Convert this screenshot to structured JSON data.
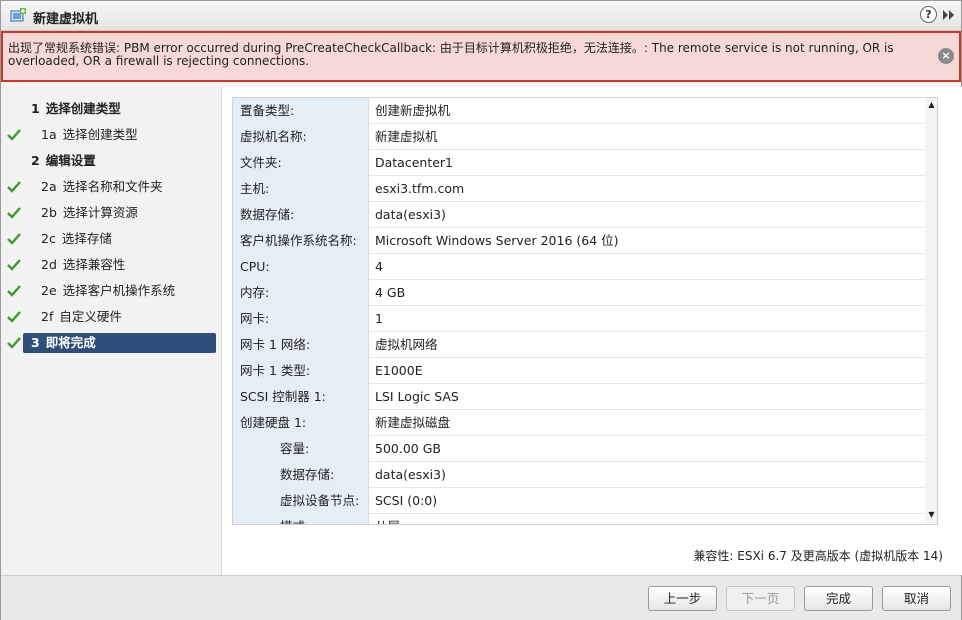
{
  "window": {
    "title": "新建虚拟机",
    "help_label": "?"
  },
  "error": {
    "message": "出现了常规系统错误: PBM error occurred during PreCreateCheckCallback: 由于目标计算机积极拒绝，无法连接。: The remote service is not running, OR is overloaded, OR a firewall is rejecting connections.",
    "close_label": "×"
  },
  "nav": {
    "items": [
      {
        "num": "1",
        "label": "选择创建类型",
        "level": "top",
        "checked": false,
        "active": false
      },
      {
        "num": "1a",
        "label": "选择创建类型",
        "level": "sub",
        "checked": true,
        "active": false
      },
      {
        "num": "2",
        "label": "编辑设置",
        "level": "top",
        "checked": false,
        "active": false
      },
      {
        "num": "2a",
        "label": "选择名称和文件夹",
        "level": "sub",
        "checked": true,
        "active": false
      },
      {
        "num": "2b",
        "label": "选择计算资源",
        "level": "sub",
        "checked": true,
        "active": false
      },
      {
        "num": "2c",
        "label": "选择存储",
        "level": "sub",
        "checked": true,
        "active": false
      },
      {
        "num": "2d",
        "label": "选择兼容性",
        "level": "sub",
        "checked": true,
        "active": false
      },
      {
        "num": "2e",
        "label": "选择客户机操作系统",
        "level": "sub",
        "checked": true,
        "active": false
      },
      {
        "num": "2f",
        "label": "自定义硬件",
        "level": "sub",
        "checked": true,
        "active": false
      },
      {
        "num": "3",
        "label": "即将完成",
        "level": "top",
        "checked": true,
        "active": true
      }
    ]
  },
  "summary": {
    "rows": [
      {
        "key": "置备类型:",
        "value": "创建新虚拟机",
        "indent": false
      },
      {
        "key": "虚拟机名称:",
        "value": "新建虚拟机",
        "indent": false
      },
      {
        "key": "文件夹:",
        "value": "Datacenter1",
        "indent": false
      },
      {
        "key": "主机:",
        "value": "esxi3.tfm.com",
        "indent": false
      },
      {
        "key": "数据存储:",
        "value": "data(esxi3)",
        "indent": false
      },
      {
        "key": "客户机操作系统名称:",
        "value": "Microsoft Windows Server 2016 (64 位)",
        "indent": false
      },
      {
        "key": "CPU:",
        "value": "4",
        "indent": false
      },
      {
        "key": "内存:",
        "value": "4 GB",
        "indent": false
      },
      {
        "key": "网卡:",
        "value": "1",
        "indent": false
      },
      {
        "key": "网卡 1 网络:",
        "value": "虚拟机网络",
        "indent": false
      },
      {
        "key": "网卡 1 类型:",
        "value": "E1000E",
        "indent": false
      },
      {
        "key": "SCSI 控制器 1:",
        "value": "LSI Logic SAS",
        "indent": false
      },
      {
        "key": "创建硬盘 1:",
        "value": "新建虚拟磁盘",
        "indent": false
      },
      {
        "key": "容量:",
        "value": "500.00 GB",
        "indent": true
      },
      {
        "key": "数据存储:",
        "value": "data(esxi3)",
        "indent": true
      },
      {
        "key": "虚拟设备节点:",
        "value": "SCSI (0:0)",
        "indent": true
      },
      {
        "key": "模式:",
        "value": "从属",
        "indent": true
      }
    ],
    "compatibility": "兼容性: ESXi 6.7 及更高版本 (虚拟机版本 14)"
  },
  "buttons": {
    "back": "上一步",
    "next": "下一页",
    "finish": "完成",
    "cancel": "取消"
  }
}
